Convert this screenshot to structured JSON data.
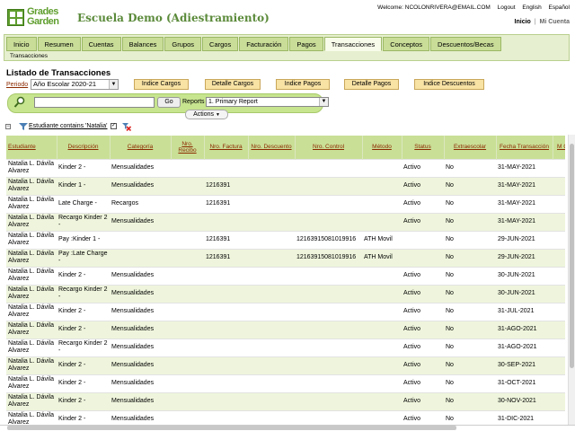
{
  "brand": {
    "logo_line1": "Grades",
    "logo_line2": "Garden",
    "colors": {
      "accent": "#5f9e2e",
      "tab": "#c9dd98",
      "header": "#c9df96",
      "alt_row": "#eef5dc"
    }
  },
  "app_title": "Escuela Demo (Adiestramiento)",
  "top_links": {
    "welcome": "Welcome: NCOLONRIVERA@EMAIL.COM",
    "logout": "Logout",
    "english": "English",
    "espanol": "Español"
  },
  "user_nav": {
    "home": "Inicio",
    "sep": "|",
    "my_account": "Mi Cuenta"
  },
  "tabs": [
    "Inicio",
    "Resumen",
    "Cuentas",
    "Balances",
    "Grupos",
    "Cargos",
    "Facturación",
    "Pagos",
    "Transacciones",
    "Conceptos",
    "Descuentos/Becas"
  ],
  "active_tab": "Transacciones",
  "subtab": "Transacciones",
  "page_title": "Listado de Transacciones",
  "period": {
    "label": "Periodo",
    "value": "Año Escolar 2020-21"
  },
  "index_buttons": [
    "Indice Cargos",
    "Detalle Cargos",
    "Indice Pagos",
    "Detalle Pagos",
    "Indice Descuentos"
  ],
  "search": {
    "go_label": "Go",
    "reports_label": "Reports",
    "report_value": "1. Primary Report",
    "actions_label": "Actions"
  },
  "filter": {
    "text": "Estudiante contains 'Natalia'"
  },
  "table": {
    "headers": [
      "Estudiante",
      "Descripción",
      "Categoría",
      "Nro. Recibo",
      "Nro. Factura",
      "Nro. Descuento",
      "Nro. Control",
      "Método",
      "Status",
      "Extraescolar",
      "Fecha Transacción",
      "M C"
    ],
    "rows": [
      [
        "Natalia L. Dávila Alvarez",
        "Kinder 2 -",
        "Mensualidades",
        "",
        "",
        "",
        "",
        "",
        "Activo",
        "No",
        "31-MAY-2021"
      ],
      [
        "Natalia L. Dávila Alvarez",
        "Kinder 1 -",
        "Mensualidades",
        "",
        "1216391",
        "",
        "",
        "",
        "Activo",
        "No",
        "31-MAY-2021"
      ],
      [
        "Natalia L. Dávila Alvarez",
        "Late Charge -",
        "Recargos",
        "",
        "1216391",
        "",
        "",
        "",
        "Activo",
        "No",
        "31-MAY-2021"
      ],
      [
        "Natalia L. Dávila Alvarez",
        "Recargo Kinder 2 -",
        "Mensualidades",
        "",
        "",
        "",
        "",
        "",
        "Activo",
        "No",
        "31-MAY-2021"
      ],
      [
        "Natalia L. Dávila Alvarez",
        "Pay :Kinder 1 -",
        "",
        "",
        "1216391",
        "",
        "12163915081019916",
        "ATH Movil",
        "",
        "No",
        "29-JUN-2021"
      ],
      [
        "Natalia L. Dávila Alvarez",
        "Pay :Late Charge -",
        "",
        "",
        "1216391",
        "",
        "12163915081019916",
        "ATH Movil",
        "",
        "No",
        "29-JUN-2021"
      ],
      [
        "Natalia L. Dávila Alvarez",
        "Kinder 2 -",
        "Mensualidades",
        "",
        "",
        "",
        "",
        "",
        "Activo",
        "No",
        "30-JUN-2021"
      ],
      [
        "Natalia L. Dávila Alvarez",
        "Recargo Kinder 2 -",
        "Mensualidades",
        "",
        "",
        "",
        "",
        "",
        "Activo",
        "No",
        "30-JUN-2021"
      ],
      [
        "Natalia L. Dávila Alvarez",
        "Kinder 2 -",
        "Mensualidades",
        "",
        "",
        "",
        "",
        "",
        "Activo",
        "No",
        "31-JUL-2021"
      ],
      [
        "Natalia L. Dávila Alvarez",
        "Kinder 2 -",
        "Mensualidades",
        "",
        "",
        "",
        "",
        "",
        "Activo",
        "No",
        "31-AGO-2021"
      ],
      [
        "Natalia L. Dávila Alvarez",
        "Recargo Kinder 2 -",
        "Mensualidades",
        "",
        "",
        "",
        "",
        "",
        "Activo",
        "No",
        "31-AGO-2021"
      ],
      [
        "Natalia L. Dávila Alvarez",
        "Kinder 2 -",
        "Mensualidades",
        "",
        "",
        "",
        "",
        "",
        "Activo",
        "No",
        "30-SEP-2021"
      ],
      [
        "Natalia L. Dávila Alvarez",
        "Kinder 2 -",
        "Mensualidades",
        "",
        "",
        "",
        "",
        "",
        "Activo",
        "No",
        "31-OCT-2021"
      ],
      [
        "Natalia L. Dávila Alvarez",
        "Kinder 2 -",
        "Mensualidades",
        "",
        "",
        "",
        "",
        "",
        "Activo",
        "No",
        "30-NOV-2021"
      ],
      [
        "Natalia L. Dávila Alvarez",
        "Kinder 2 -",
        "Mensualidades",
        "",
        "",
        "",
        "",
        "",
        "Activo",
        "No",
        "31-DIC-2021"
      ]
    ]
  }
}
